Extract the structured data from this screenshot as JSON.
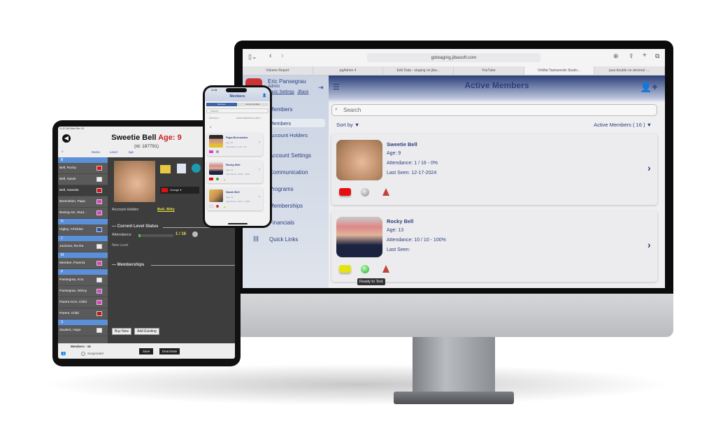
{
  "browser": {
    "url": "gdstaging.jibasoft.com",
    "tabs": [
      "Volume Report",
      "pgAdmin 4",
      "Edit Data - staging on jiba...",
      "YouTube",
      "OnMat Taekwondo Studio...",
      "java double no decimal -..."
    ],
    "active_tab": 4
  },
  "sidebar": {
    "user_name": "Eric Pansegrau",
    "role": "Admin",
    "links": [
      "Basic Settings",
      "JBack"
    ],
    "items": [
      "Members",
      "Members",
      "Account Holders",
      "Account Settings",
      "Communication",
      "Programs",
      "Memberships",
      "Financials",
      "Quick Links"
    ]
  },
  "desktop": {
    "title": "Active Members",
    "search_placeholder": "Search",
    "sort_label": "Sort by",
    "filter_label": "Active Members ( 16 )",
    "members": [
      {
        "name": "Sweetie Bell",
        "age": "Age: 9",
        "attendance": "Attendance: 1 / 16 - 0%",
        "last_seen": "Last Seen: 12-17-2024",
        "belt_color": "#e50f0f",
        "test_status": "gray"
      },
      {
        "name": "Rocky Bell",
        "age": "Age: 13",
        "attendance": "Attendance: 10 / 10 - 100%",
        "last_seen": "Last Seen:",
        "belt_color": "#e3e312",
        "test_status": "green"
      }
    ],
    "tooltip": "Ready to Test"
  },
  "tablet": {
    "status": "11:57 AM  Wed Dec 18",
    "name": "Sweetie Bell",
    "age": "Age: 9",
    "id": "(Id: 187791)",
    "columns": [
      "Name",
      "Level",
      "Age"
    ],
    "list": [
      {
        "header": "B"
      },
      {
        "name": "Bell, Rocky",
        "color": "#e01010"
      },
      {
        "name": "Bell, Sarah",
        "color": "#eeeeee"
      },
      {
        "name": "Bell, Sweetie",
        "color": "#e01010",
        "selected": true
      },
      {
        "name": "Berenstien, Papa",
        "color": "#e040c8"
      },
      {
        "name": "Boxing AH, Stud...",
        "color": "#e040c8"
      },
      {
        "header": "H"
      },
      {
        "name": "Higley, APickles",
        "color": "#3050c0"
      },
      {
        "header": "J"
      },
      {
        "name": "Jocirous, Ra Ra",
        "color": "#eeeeee"
      },
      {
        "header": "M"
      },
      {
        "name": "Member, Parent1",
        "color": "#e040c8"
      },
      {
        "header": "P"
      },
      {
        "name": "Pansegrau, Koo",
        "color": "#eeeeee"
      },
      {
        "name": "Pansegrau, Winny",
        "color": "#e040c8"
      },
      {
        "name": "Parent ACH, Child",
        "color": "#e040c8"
      },
      {
        "name": "Parent, Child",
        "color": "#c01818"
      },
      {
        "header": "S"
      },
      {
        "name": "Student, Hope",
        "color": "#eeeeee"
      }
    ],
    "rank": "Orange",
    "account_holder_label": "Account Holder:",
    "account_holder": "Bell, Billy",
    "level_status": "Current Level Status",
    "attendance_label": "Attendance",
    "attendance_value": "1 / 16",
    "attendance_progress": 0.0625,
    "new_level": "New Level",
    "memberships": "Memberships",
    "buy_new": "Buy New",
    "add_existing": "Add Existing",
    "members_count": "Members - 16",
    "suspended": "Suspended",
    "save": "Save",
    "deactivate": "Deactivate"
  },
  "phone": {
    "time": "11:04",
    "title": "Members",
    "tabs": [
      "Members",
      "Account Holders"
    ],
    "search_placeholder": "Search",
    "sort_label": "Sort by",
    "filter_label": "Active Members (16)",
    "section": "B",
    "members": [
      {
        "name": "Papa Berenstien",
        "age": "Age: 30",
        "attendance": "Attendance: 1/10 - 0%",
        "belt_color": "#e040c8"
      },
      {
        "name": "Rocky Bell",
        "age": "Age: 13",
        "attendance": "Attendance: 11/16 - 100%",
        "belt_color": "#e01010"
      },
      {
        "name": "Sarah Bell",
        "age": "Age: 23",
        "attendance": "Attendance: 10/16 - 100%",
        "belt_color": "#f4f4f4"
      }
    ]
  }
}
